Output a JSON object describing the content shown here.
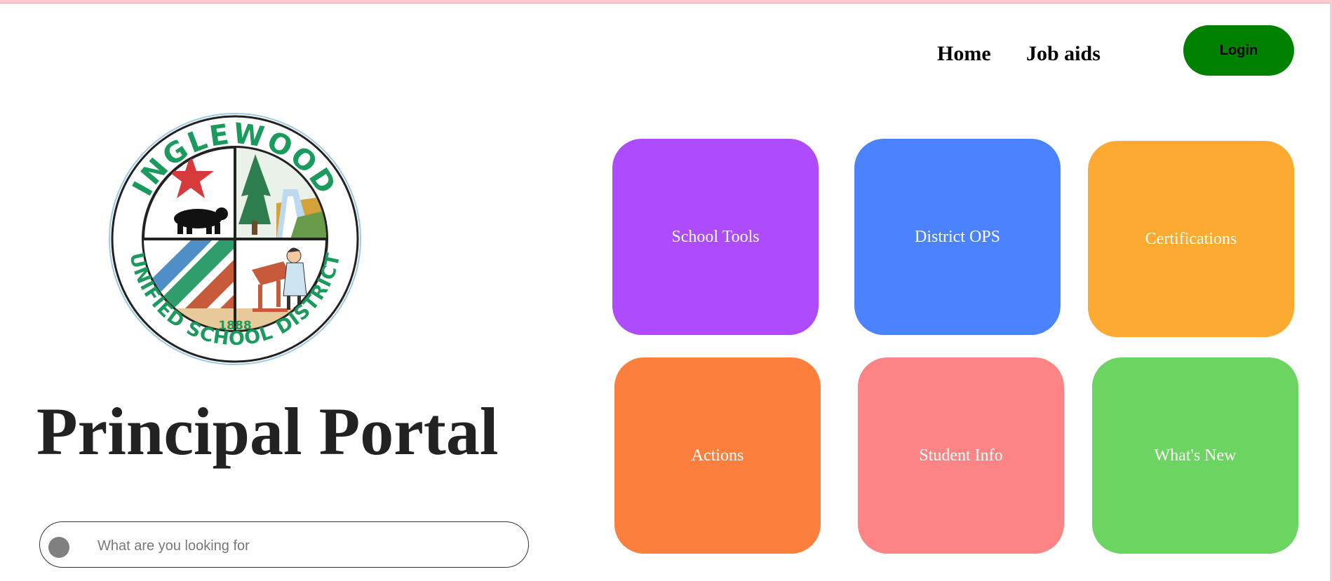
{
  "nav": {
    "home_label": "Home",
    "jobaids_label": "Job aids",
    "login_label": "Login",
    "login_color": "#008000"
  },
  "logo": {
    "top_text": "INGLEWOOD",
    "bottom_text": "UNIFIED SCHOOL DISTRICT",
    "year": "1888"
  },
  "page": {
    "title": "Principal Portal"
  },
  "search": {
    "placeholder": "What are you looking for",
    "value": ""
  },
  "tiles": [
    {
      "label": "School Tools",
      "color": "#ad4bfd"
    },
    {
      "label": "District OPS",
      "color": "#4b82fd"
    },
    {
      "label": "Certifications",
      "color": "#fdaa33"
    },
    {
      "label": "Actions",
      "color": "#fd7f3e"
    },
    {
      "label": "Student Info",
      "color": "#fd8484"
    },
    {
      "label": "What's New",
      "color": "#6cd562"
    }
  ]
}
